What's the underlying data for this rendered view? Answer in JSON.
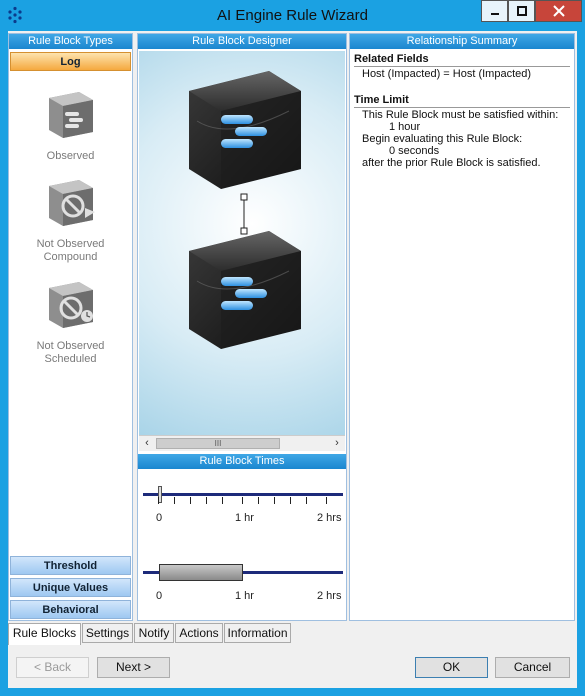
{
  "window": {
    "title": "AI Engine Rule Wizard"
  },
  "left_panel": {
    "header": "Rule Block Types",
    "categories_top": [
      {
        "label": "Log",
        "active": true
      }
    ],
    "items": [
      {
        "label": "Observed"
      },
      {
        "label": "Not Observed Compound"
      },
      {
        "label": "Not Observed Scheduled"
      }
    ],
    "categories_bottom": [
      {
        "label": "Threshold"
      },
      {
        "label": "Unique Values"
      },
      {
        "label": "Behavioral"
      }
    ]
  },
  "middle_panel": {
    "header": "Rule Block Designer",
    "times_header": "Rule Block Times",
    "scroll_thumb": "III",
    "slider1": {
      "labels": [
        "0",
        "1 hr",
        "2 hrs"
      ],
      "value_hours": 0
    },
    "slider2": {
      "labels": [
        "0",
        "1 hr",
        "2 hrs"
      ],
      "range_hours": [
        0,
        1
      ]
    }
  },
  "right_panel": {
    "header": "Relationship Summary",
    "related_fields_title": "Related Fields",
    "related_fields": "Host (Impacted) = Host (Impacted)",
    "time_limit_title": "Time Limit",
    "line1": "This Rule Block must be satisfied within:",
    "line2": "1 hour",
    "line3": "Begin evaluating this Rule Block:",
    "line4": "0 seconds",
    "line5": "after the prior Rule Block is satisfied."
  },
  "tabs": [
    "Rule Blocks",
    "Settings",
    "Notify",
    "Actions",
    "Information"
  ],
  "buttons": {
    "back": "< Back",
    "next": "Next >",
    "ok": "OK",
    "cancel": "Cancel"
  },
  "colors": {
    "title_bar": "#1ba1e2",
    "active_category": "#f5a93f",
    "track": "#1d2a7a"
  }
}
